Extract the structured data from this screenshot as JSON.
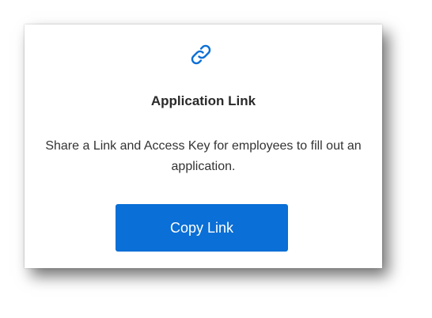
{
  "card": {
    "icon": "link-icon",
    "title": "Application Link",
    "description": "Share a Link and Access Key for employees to fill out an application.",
    "button_label": "Copy Link"
  },
  "colors": {
    "accent": "#0a6fd6",
    "title_text": "#2a2a2a",
    "body_text": "#333333"
  }
}
